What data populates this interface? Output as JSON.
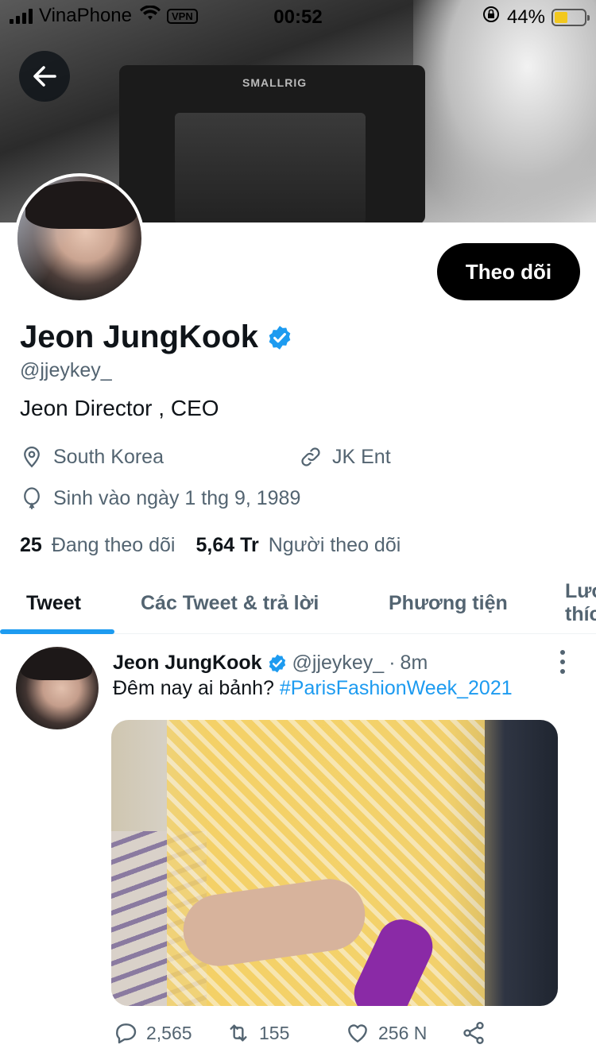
{
  "status_bar": {
    "carrier": "VinaPhone",
    "vpn": "VPN",
    "time": "00:52",
    "battery_percent": "44%"
  },
  "banner": {
    "brand_text": "SMALLRIG"
  },
  "profile": {
    "follow_label": "Theo dõi",
    "name": "Jeon JungKook",
    "handle": "@jjeykey_",
    "bio": "Jeon Director , CEO",
    "location": "South Korea",
    "website": "JK Ent",
    "birthday": "Sinh vào ngày 1 thg 9, 1989",
    "following_count": "25",
    "following_label": "Đang theo dõi",
    "followers_count": "5,64 Tr",
    "followers_label": "Người theo dõi"
  },
  "tabs": [
    {
      "label": "Tweet"
    },
    {
      "label": "Các Tweet & trả lời"
    },
    {
      "label": "Phương tiện"
    },
    {
      "label": "Lượt thích"
    }
  ],
  "tweet": {
    "name": "Jeon JungKook",
    "handle": "@jjeykey_",
    "separator": "·",
    "time": "8m",
    "text": "Đêm nay ai bảnh?",
    "hashtag": "#ParisFashionWeek_2021",
    "replies": "2,565",
    "retweets": "155",
    "likes": "256 N"
  },
  "colors": {
    "accent": "#1d9bf0",
    "text_secondary": "#536471",
    "battery": "#f2c81f"
  },
  "icons": [
    "back-arrow-icon",
    "verified-icon",
    "location-icon",
    "link-icon",
    "balloon-icon",
    "more-icon",
    "reply-icon",
    "retweet-icon",
    "like-icon",
    "share-icon"
  ]
}
